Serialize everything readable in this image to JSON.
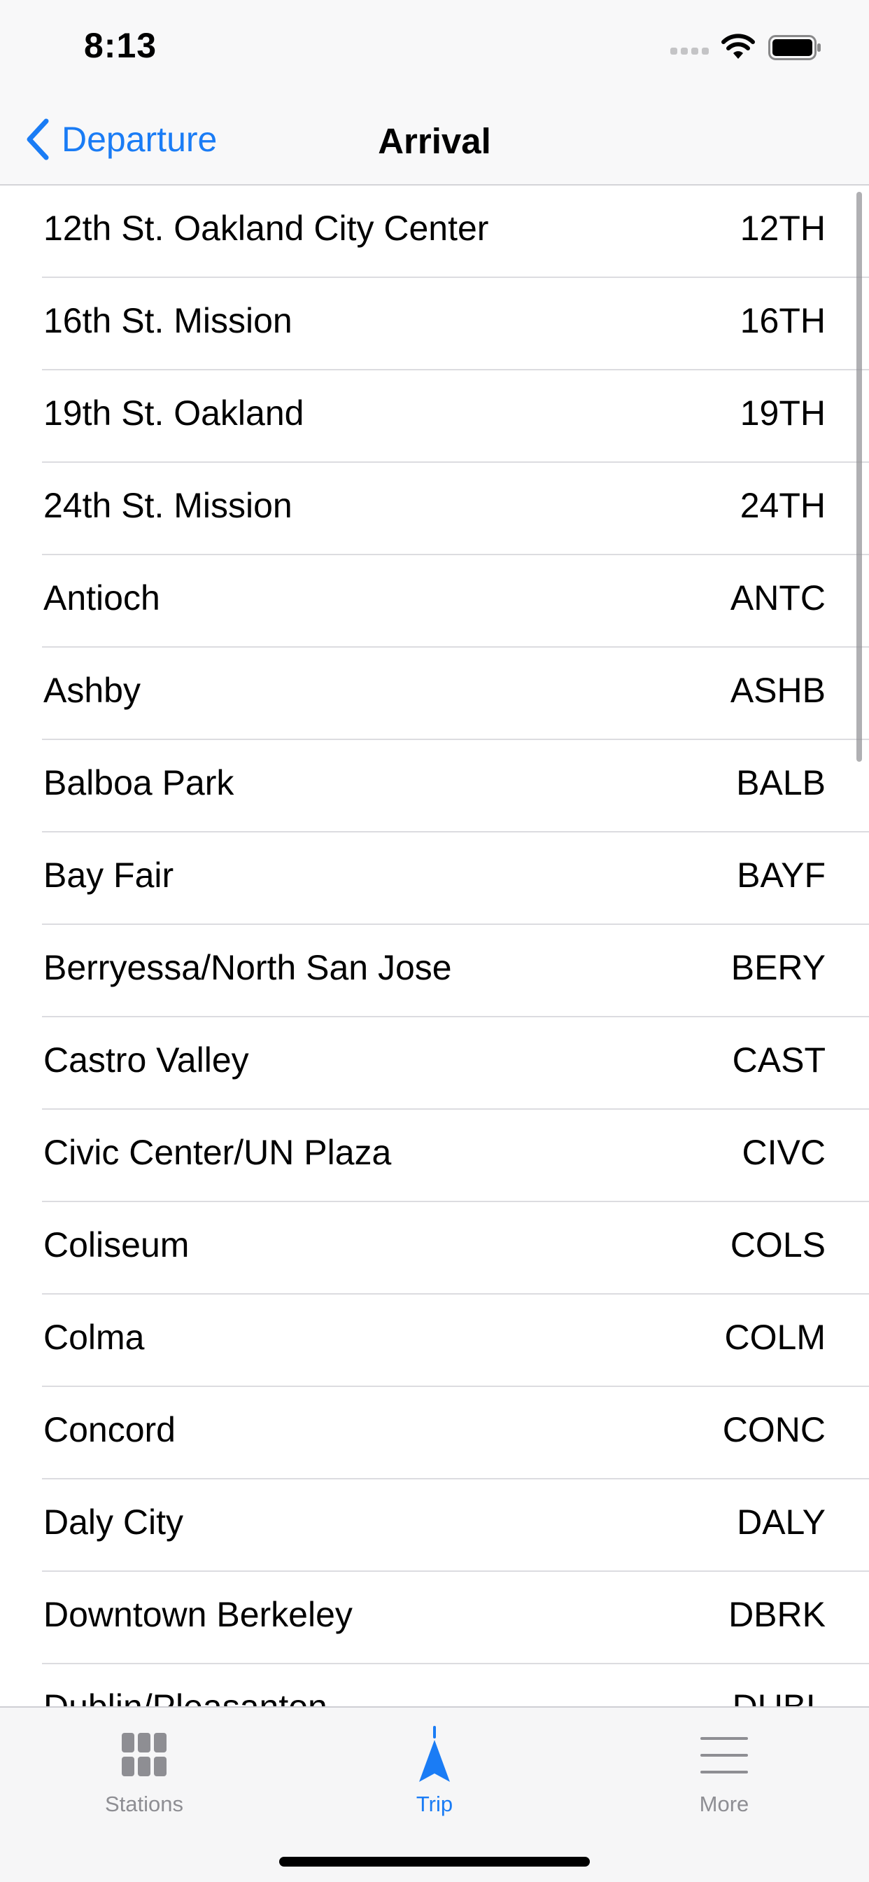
{
  "status_bar": {
    "time": "8:13"
  },
  "nav": {
    "back_label": "Departure",
    "title": "Arrival"
  },
  "stations": [
    {
      "name": "12th St. Oakland City Center",
      "code": "12TH"
    },
    {
      "name": "16th St. Mission",
      "code": "16TH"
    },
    {
      "name": "19th St. Oakland",
      "code": "19TH"
    },
    {
      "name": "24th St. Mission",
      "code": "24TH"
    },
    {
      "name": "Antioch",
      "code": "ANTC"
    },
    {
      "name": "Ashby",
      "code": "ASHB"
    },
    {
      "name": "Balboa Park",
      "code": "BALB"
    },
    {
      "name": "Bay Fair",
      "code": "BAYF"
    },
    {
      "name": "Berryessa/North San Jose",
      "code": "BERY"
    },
    {
      "name": "Castro Valley",
      "code": "CAST"
    },
    {
      "name": "Civic Center/UN Plaza",
      "code": "CIVC"
    },
    {
      "name": "Coliseum",
      "code": "COLS"
    },
    {
      "name": "Colma",
      "code": "COLM"
    },
    {
      "name": "Concord",
      "code": "CONC"
    },
    {
      "name": "Daly City",
      "code": "DALY"
    },
    {
      "name": "Downtown Berkeley",
      "code": "DBRK"
    },
    {
      "name": "Dublin/Pleasanton",
      "code": "DUBL"
    }
  ],
  "tabs": [
    {
      "label": "Stations",
      "icon": "grid-icon",
      "active": false
    },
    {
      "label": "Trip",
      "icon": "navigation-arrow-icon",
      "active": true
    },
    {
      "label": "More",
      "icon": "menu-lines-icon",
      "active": false
    }
  ],
  "colors": {
    "accent": "#1a7cf5",
    "inactive_tab": "#8e8e93"
  }
}
